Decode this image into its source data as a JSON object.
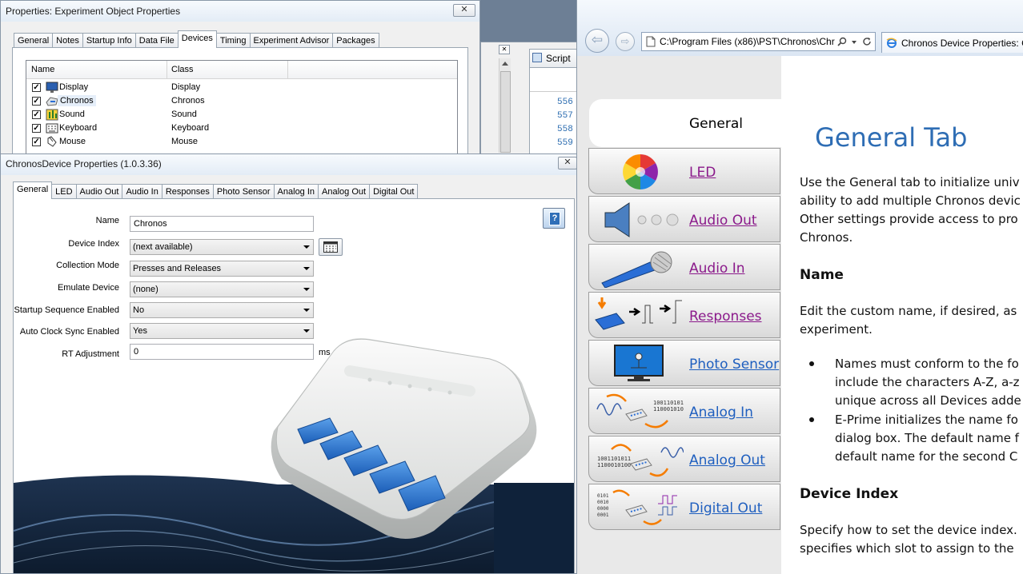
{
  "exp_window": {
    "title": "Properties: Experiment Object Properties",
    "close_glyph": "✕",
    "tabs": [
      "General",
      "Notes",
      "Startup Info",
      "Data File",
      "Devices",
      "Timing",
      "Experiment Advisor",
      "Packages"
    ],
    "active_tab": "Devices",
    "columns": [
      "Name",
      "Class"
    ],
    "rows": [
      {
        "name": "Display",
        "class": "Display",
        "checked": true,
        "icon": "display-icon"
      },
      {
        "name": "Chronos",
        "class": "Chronos",
        "checked": true,
        "icon": "chronos-icon"
      },
      {
        "name": "Sound",
        "class": "Sound",
        "checked": true,
        "icon": "sound-icon"
      },
      {
        "name": "Keyboard",
        "class": "Keyboard",
        "checked": true,
        "icon": "keyboard-icon"
      },
      {
        "name": "Mouse",
        "class": "Mouse",
        "checked": true,
        "icon": "mouse-icon"
      }
    ]
  },
  "script_window": {
    "tab_label": "Script",
    "line_numbers": [
      "556",
      "557",
      "558",
      "559"
    ]
  },
  "chronos_window": {
    "title": "ChronosDevice Properties (1.0.3.36)",
    "close_glyph": "✕",
    "tabs": [
      "General",
      "LED",
      "Audio Out",
      "Audio In",
      "Responses",
      "Photo Sensor",
      "Analog In",
      "Analog Out",
      "Digital Out"
    ],
    "active_tab": "General",
    "fields": {
      "name_label": "Name",
      "name_value": "Chronos",
      "device_index_label": "Device Index",
      "device_index_value": "(next available)",
      "collection_mode_label": "Collection Mode",
      "collection_mode_value": "Presses and Releases",
      "emulate_device_label": "Emulate Device",
      "emulate_device_value": "(none)",
      "startup_seq_label": "Startup Sequence Enabled",
      "startup_seq_value": "No",
      "auto_clock_label": "Auto Clock Sync Enabled",
      "auto_clock_value": "Yes",
      "rt_adjust_label": "RT Adjustment",
      "rt_adjust_value": "0",
      "rt_adjust_unit": "ms"
    },
    "help_glyph": "?"
  },
  "browser": {
    "address": "C:\\Program Files (x86)\\PST\\Chronos\\Chr",
    "tab_title": "Chronos Device Properties: G",
    "back_glyph": "⇦",
    "forward_glyph": "⇨"
  },
  "help_nav": {
    "header": "General",
    "items": [
      {
        "label": "LED",
        "color": "#8b1a8b"
      },
      {
        "label": "Audio Out",
        "color": "#8b1a8b"
      },
      {
        "label": "Audio In",
        "color": "#8b1a8b"
      },
      {
        "label": "Responses",
        "color": "#8b1a8b"
      },
      {
        "label": "Photo Sensor",
        "color": "#1f5fbf"
      },
      {
        "label": "Analog In",
        "color": "#1f5fbf"
      },
      {
        "label": "Analog Out",
        "color": "#1f5fbf"
      },
      {
        "label": "Digital Out",
        "color": "#1f5fbf"
      }
    ]
  },
  "help_content": {
    "title": "General Tab",
    "intro_lines": [
      "Use the General tab to initialize univ",
      "ability to add multiple Chronos devic",
      "Other settings provide access to pro",
      "Chronos."
    ],
    "section_name": "Name",
    "name_lines": [
      "Edit the custom name, if desired, as",
      "experiment."
    ],
    "bullet1_lines": [
      "Names must conform to the fo",
      "include the characters A-Z, a-z",
      "unique across all Devices adde"
    ],
    "bullet2_lines": [
      "E-Prime initializes the name fo",
      "dialog box. The default name f",
      "default name for the second C"
    ],
    "section_device_index": "Device Index",
    "device_index_lines": [
      "Specify how to set the device index.",
      "specifies which slot to assign to the"
    ]
  },
  "colors": {
    "title_blue": "#2e6db4",
    "link_visited": "#8b1a8b",
    "link": "#1f5fbf"
  }
}
